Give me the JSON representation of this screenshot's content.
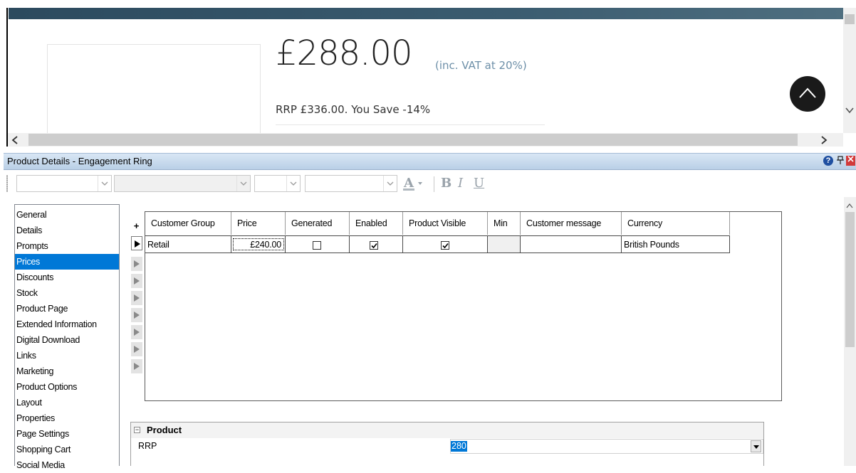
{
  "web_preview": {
    "price": "£288.00",
    "vat_note": "(inc. VAT at 20%)",
    "rrp_line": "RRP £336.00. You Save -14%"
  },
  "panel": {
    "title": "Product Details - Engagement Ring"
  },
  "nav": {
    "items": [
      "General",
      "Details",
      "Prompts",
      "Prices",
      "Discounts",
      "Stock",
      "Product Page",
      "Extended Information",
      "Digital Download",
      "Links",
      "Marketing",
      "Product Options",
      "Layout",
      "Properties",
      "Page Settings",
      "Shopping Cart",
      "Social Media"
    ],
    "selected": "Prices"
  },
  "grid": {
    "add_symbol": "+",
    "columns": [
      "Customer Group",
      "Price",
      "Generated",
      "Enabled",
      "Product Visible",
      "Min",
      "Customer message",
      "Currency"
    ],
    "rows": [
      {
        "customer_group": "Retail",
        "price": "£240.00",
        "generated": false,
        "enabled": true,
        "product_visible": true,
        "min": "",
        "customer_message": "",
        "currency": "British Pounds"
      }
    ]
  },
  "property_grid": {
    "category": "Product",
    "property_name": "RRP",
    "property_value": "280"
  },
  "colors": {
    "selection": "#0078d7",
    "title_bar": "#c9dbee",
    "web_band": "#2c4a5e",
    "vat_text": "#6d8fa8"
  }
}
